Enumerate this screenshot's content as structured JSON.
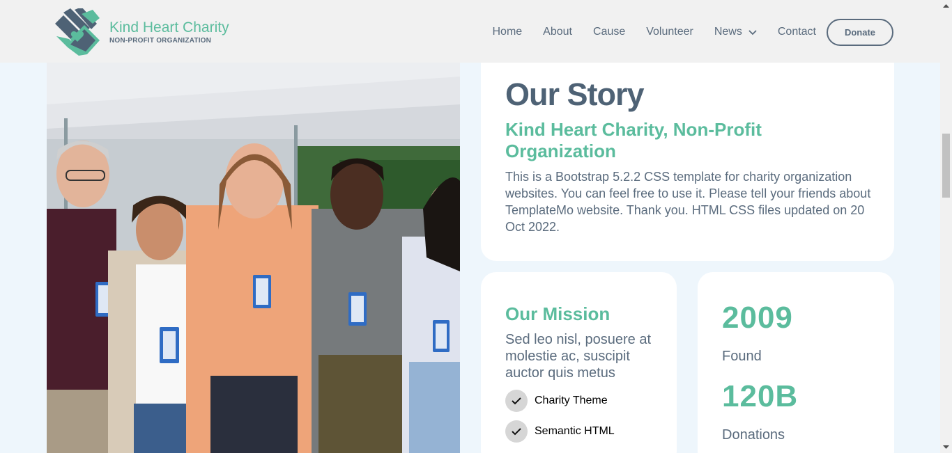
{
  "header": {
    "brand_name": "Kind Heart Charity",
    "brand_tagline": "NON-PROFIT ORGANIZATION",
    "nav_items": [
      {
        "label": "Home"
      },
      {
        "label": "About"
      },
      {
        "label": "Cause"
      },
      {
        "label": "Volunteer"
      },
      {
        "label": "News",
        "icon": "chevron-down-icon"
      },
      {
        "label": "Contact"
      }
    ],
    "donate_label": "Donate"
  },
  "colors": {
    "accent": "#5bbc9d",
    "text": "#5a6b7d",
    "heading": "#4e6275",
    "page_bg": "#eef6fc",
    "header_bg": "#f1f1f1"
  },
  "story": {
    "title": "Our Story",
    "subtitle": "Kind Heart Charity, Non-Profit Organization",
    "text": "This is a Bootstrap 5.2.2 CSS template for charity organization websites. You can feel free to use it. Please tell your friends about TemplateMo website. Thank you. HTML CSS files updated on 20 Oct 2022."
  },
  "mission": {
    "title": "Our Mission",
    "text": "Sed leo nisl, posuere at molestie ac, suscipit auctor quis metus",
    "items": [
      {
        "label": "Charity Theme",
        "icon": "check-icon"
      },
      {
        "label": "Semantic HTML",
        "icon": "check-icon"
      }
    ]
  },
  "stats": [
    {
      "number": "2009",
      "label": "Found"
    },
    {
      "number": "120B",
      "label": "Donations"
    }
  ]
}
